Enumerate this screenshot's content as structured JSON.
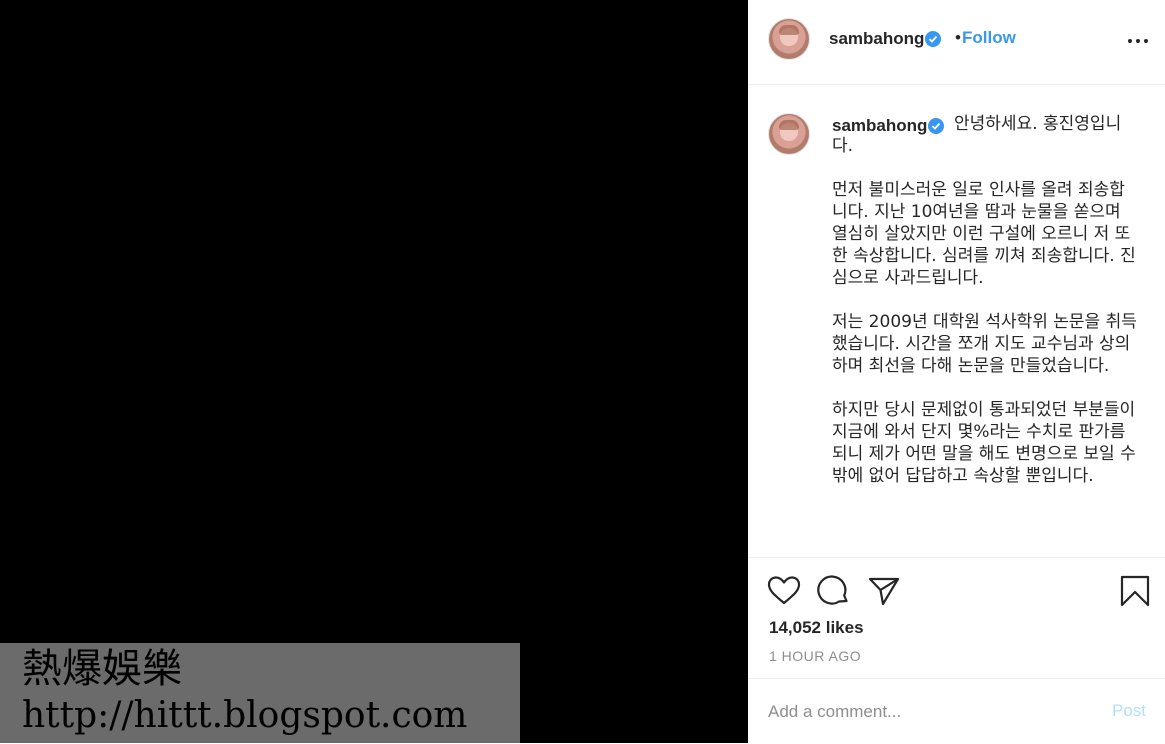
{
  "watermark": {
    "line1": "熱爆娛樂",
    "line2": "http://hittt.blogspot.com"
  },
  "post": {
    "username": "sambahong",
    "follow_label": "Follow",
    "separator": "•",
    "caption": {
      "username": "sambahong",
      "paragraphs": [
        "안녕하세요. 홍진영입니다.",
        "먼저 불미스러운 일로 인사를 올려 죄송합니다. 지난 10여년을 땀과 눈물을 쏟으며 열심히 살았지만 이런 구설에 오르니 저 또한 속상합니다. 심려를 끼쳐 죄송합니다. 진심으로 사과드립니다.",
        "저는 2009년 대학원 석사학위 논문을 취득했습니다. 시간을 쪼개 지도 교수님과 상의하며 최선을 다해 논문을 만들었습니다.",
        "하지만 당시 문제없이 통과되었던 부분들이 지금에 와서 단지 몇%라는 수치로 판가름되니 제가 어떤 말을 해도 변명으로 보일 수 밖에 없어 답답하고 속상할 뿐입니다."
      ]
    },
    "likes": "14,052 likes",
    "time": "1 HOUR AGO",
    "comment": {
      "placeholder": "Add a comment...",
      "post_label": "Post"
    }
  },
  "colors": {
    "accent": "#3897f0",
    "post_disabled": "#b2dffc",
    "muted": "#8e8e8e",
    "text": "#262626"
  },
  "icons": [
    "verified-badge-icon",
    "more-options-icon",
    "heart-icon",
    "comment-icon",
    "share-icon",
    "bookmark-icon"
  ]
}
